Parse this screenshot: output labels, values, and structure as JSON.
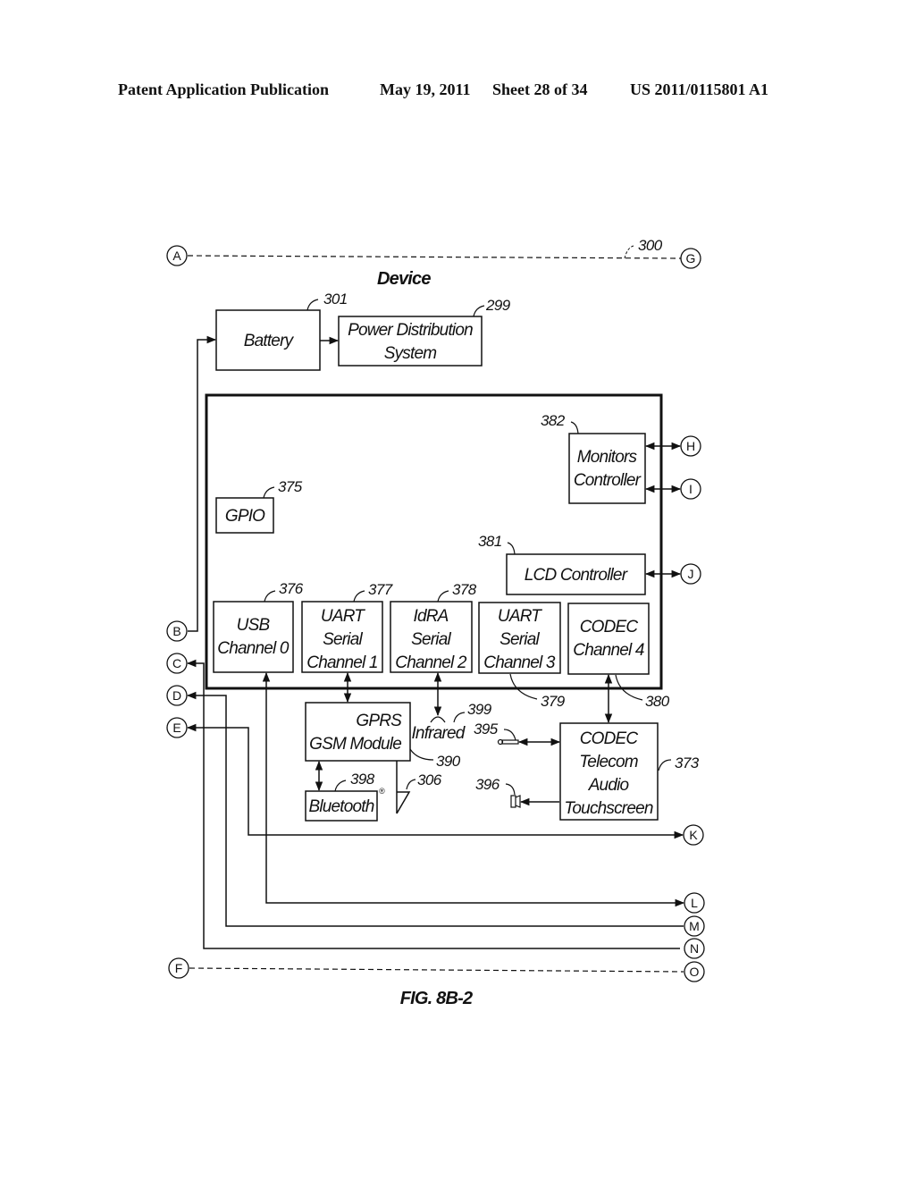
{
  "header": {
    "publication": "Patent Application Publication",
    "date": "May 19, 2011",
    "sheet": "Sheet 28 of 34",
    "number": "US 2011/0115801 A1"
  },
  "diagram": {
    "title": "Device",
    "title_ref": "300",
    "figure_caption": "FIG. 8B-2",
    "blocks": {
      "battery": {
        "lines": [
          "Battery"
        ],
        "ref": "301"
      },
      "power": {
        "lines": [
          "Power Distribution",
          "System"
        ],
        "ref": "299"
      },
      "monitors": {
        "lines": [
          "Monitors",
          "Controller"
        ],
        "ref": "382"
      },
      "gpio": {
        "lines": [
          "GPIO"
        ],
        "ref": "375"
      },
      "lcd": {
        "lines": [
          "LCD Controller"
        ],
        "ref": "381"
      },
      "usb": {
        "lines": [
          "USB",
          "Channel 0"
        ],
        "ref": "376"
      },
      "uart1": {
        "lines": [
          "UART",
          "Serial",
          "Channel 1"
        ],
        "ref": "377"
      },
      "idra": {
        "lines": [
          "IdRA",
          "Serial",
          "Channel 2"
        ],
        "ref": "378"
      },
      "uart3": {
        "lines": [
          "UART",
          "Serial",
          "Channel 3"
        ],
        "ref": "379"
      },
      "codec4": {
        "lines": [
          "CODEC",
          "Channel 4"
        ],
        "ref": "380"
      },
      "gsm": {
        "lines": [
          "GPRS",
          "GSM Module"
        ],
        "ref": "390"
      },
      "bluetooth": {
        "lines": [
          "Bluetooth"
        ],
        "ref": "398",
        "mark": "®"
      },
      "codec_telecom": {
        "lines": [
          "CODEC",
          "Telecom",
          "Audio",
          "Touchscreen"
        ],
        "ref": "373"
      }
    },
    "components": {
      "infrared": {
        "label": "Infrared",
        "ref": "399"
      },
      "antenna": {
        "ref": "306"
      },
      "microphone": {
        "ref": "395"
      },
      "speaker": {
        "ref": "396"
      }
    },
    "connectors": [
      "A",
      "B",
      "C",
      "D",
      "E",
      "F",
      "G",
      "H",
      "I",
      "J",
      "K",
      "L",
      "M",
      "N",
      "O"
    ]
  }
}
